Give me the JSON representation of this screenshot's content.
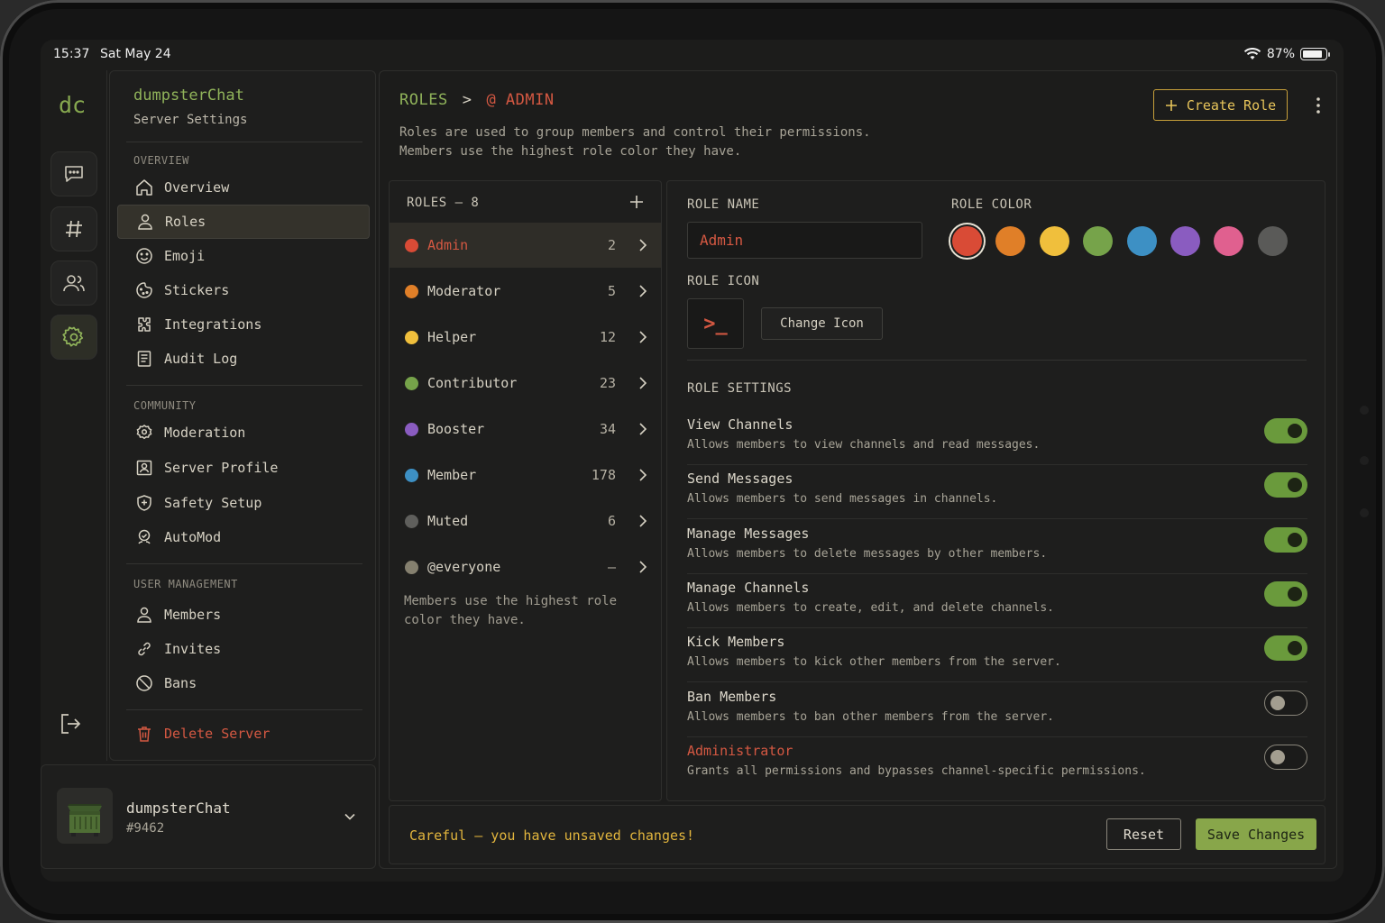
{
  "status_bar": {
    "time": "15:37",
    "date": "Sat May 24",
    "battery": "87%",
    "battery_level": 0.87
  },
  "app": {
    "logo": "dc"
  },
  "rail": {
    "items": [
      {
        "icon": "chat-icon",
        "active": false
      },
      {
        "icon": "hash-icon",
        "active": false
      },
      {
        "icon": "users-icon",
        "active": false
      },
      {
        "icon": "gear-icon",
        "active": true
      }
    ],
    "logout_icon": "logout-icon"
  },
  "sidebar": {
    "server_name": "dumpsterChat",
    "subtitle": "Server Settings",
    "sections": [
      {
        "title": "OVERVIEW",
        "items": [
          {
            "label": "Overview",
            "icon": "home-icon"
          },
          {
            "label": "Roles",
            "icon": "user-icon",
            "active": true
          },
          {
            "label": "Emoji",
            "icon": "smiley-icon"
          },
          {
            "label": "Stickers",
            "icon": "sticker-icon"
          },
          {
            "label": "Integrations",
            "icon": "puzzle-icon"
          },
          {
            "label": "Audit Log",
            "icon": "document-icon"
          }
        ]
      },
      {
        "title": "COMMUNITY",
        "items": [
          {
            "label": "Moderation",
            "icon": "badge-icon"
          },
          {
            "label": "Server Profile",
            "icon": "profile-card-icon"
          },
          {
            "label": "Safety Setup",
            "icon": "shield-icon"
          },
          {
            "label": "AutoMod",
            "icon": "automod-icon"
          }
        ]
      },
      {
        "title": "USER MANAGEMENT",
        "items": [
          {
            "label": "Members",
            "icon": "user-icon"
          },
          {
            "label": "Invites",
            "icon": "link-icon"
          },
          {
            "label": "Bans",
            "icon": "ban-icon"
          }
        ]
      }
    ],
    "delete_label": "Delete Server"
  },
  "profile": {
    "name": "dumpsterChat",
    "tag": "#9462"
  },
  "header": {
    "crumb_root": "ROLES",
    "crumb_sep": ">",
    "crumb_current": "@ ADMIN",
    "description_line1": "Roles are used to group members and control their permissions.",
    "description_line2": "Members use the highest role color they have.",
    "create_role_label": "Create Role"
  },
  "roles": {
    "header": "ROLES – 8",
    "items": [
      {
        "name": "Admin",
        "count": "2",
        "color": "#d94b36",
        "active": true
      },
      {
        "name": "Moderator",
        "count": "5",
        "color": "#e07f28"
      },
      {
        "name": "Helper",
        "count": "12",
        "color": "#f0bf3c"
      },
      {
        "name": "Contributor",
        "count": "23",
        "color": "#76a34a"
      },
      {
        "name": "Booster",
        "count": "34",
        "color": "#8a5cc0"
      },
      {
        "name": "Member",
        "count": "178",
        "color": "#3d90c4"
      },
      {
        "name": "Muted",
        "count": "6",
        "color": "#5f5f5c"
      },
      {
        "name": "@everyone",
        "count": "—",
        "color": "#85806f"
      }
    ],
    "note": "Members use the highest role color they have."
  },
  "detail": {
    "role_name_label": "ROLE NAME",
    "role_name_value": "Admin",
    "role_color_label": "ROLE COLOR",
    "colors": [
      "#d94b36",
      "#e07f28",
      "#f0bf3c",
      "#76a34a",
      "#3d90c4",
      "#8a5cc0",
      "#e0608f",
      "#5a5a58"
    ],
    "selected_color_index": 0,
    "role_icon_label": "ROLE ICON",
    "role_icon": ">_",
    "change_icon_label": "Change Icon",
    "settings_label": "ROLE SETTINGS",
    "permissions": [
      {
        "title": "View Channels",
        "desc": "Allows members to view channels and read messages.",
        "enabled": true
      },
      {
        "title": "Send Messages",
        "desc": "Allows members to send messages in channels.",
        "enabled": true
      },
      {
        "title": "Manage Messages",
        "desc": "Allows members to delete messages by other members.",
        "enabled": true
      },
      {
        "title": "Manage Channels",
        "desc": "Allows members to create, edit, and delete channels.",
        "enabled": true
      },
      {
        "title": "Kick Members",
        "desc": "Allows members to kick other members from the server.",
        "enabled": true
      },
      {
        "title": "Ban Members",
        "desc": "Allows members to ban other members from the server.",
        "enabled": false
      },
      {
        "title": "Administrator",
        "desc": "Grants all permissions and bypasses channel-specific permissions.",
        "enabled": false,
        "danger": true
      }
    ]
  },
  "footer": {
    "warning": "Careful — you have unsaved changes!",
    "reset_label": "Reset",
    "save_label": "Save Changes"
  },
  "colors": {
    "accent_green": "#90b35a",
    "danger_red": "#d45842",
    "warning_yellow": "#e2b53d"
  }
}
